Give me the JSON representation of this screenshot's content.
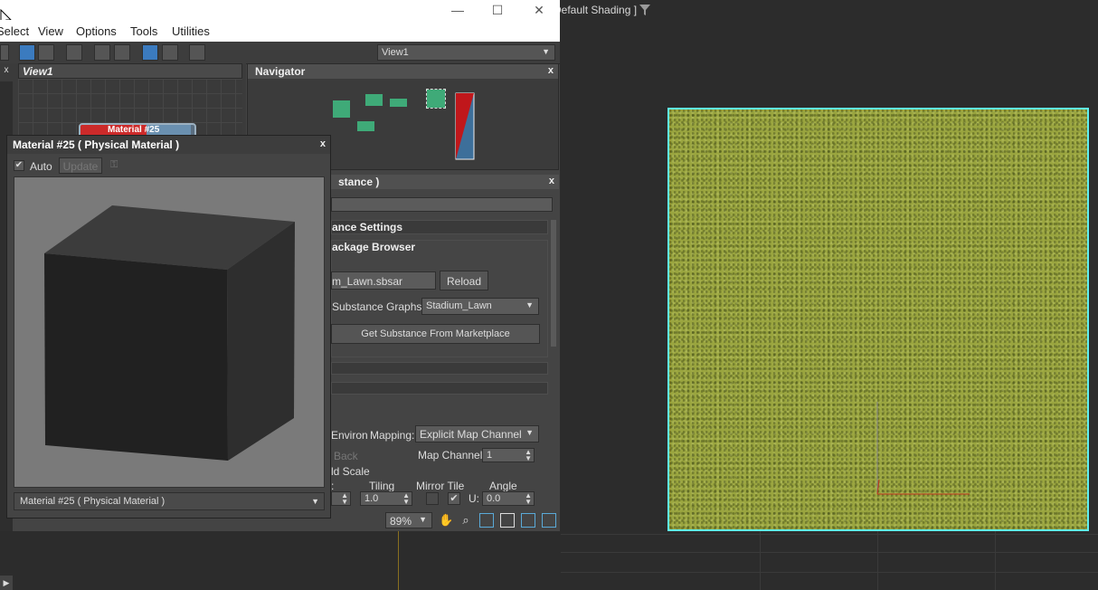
{
  "viewport": {
    "label": "Default Shading ]",
    "filter_icon": "filter-icon"
  },
  "menubar": {
    "items": [
      "Select",
      "View",
      "Options",
      "Tools",
      "Utilities"
    ]
  },
  "window_controls": {
    "minimize": "—",
    "maximize": "☐",
    "close": "✕"
  },
  "toolbar": {
    "view_select": "View1"
  },
  "view_panel": {
    "tab_label": "View1",
    "node_title": "Material #25"
  },
  "navigator": {
    "title": "Navigator",
    "close": "x"
  },
  "substance": {
    "title": "stance )",
    "close": "x",
    "rollout_settings": "ance Settings",
    "rollout_browser": "ackage Browser",
    "file_name": "m_Lawn.sbsar",
    "reload_label": "Reload",
    "graphs_label": "Substance Graphs:",
    "graph_value": "Stadium_Lawn",
    "marketplace_label": "Get Substance From Marketplace",
    "environ_label": "Environ",
    "mapping_label": "Mapping:",
    "mapping_value": "Explicit Map Channel",
    "back_label": "Back",
    "map_channel_label": "Map Channel:",
    "map_channel_value": "1",
    "world_scale_label": "ld Scale",
    "tiling_label": "Tiling",
    "mirror_tile_label": "Mirror Tile",
    "angle_label": "Angle",
    "offset_partial": ":",
    "tiling_value": "1.0",
    "u_label": "U:",
    "angle_value": "0.0"
  },
  "material_window": {
    "title": "Material #25  ( Physical Material )",
    "close": "x",
    "auto_label": "Auto",
    "update_label": "Update",
    "select_value": "Material #25  ( Physical Material )"
  },
  "bottom_bar": {
    "zoom_value": "89%"
  },
  "colors": {
    "selection_outline": "#5ff0f0",
    "node_green": "#3faa78",
    "lawn": "#9aa53f"
  }
}
